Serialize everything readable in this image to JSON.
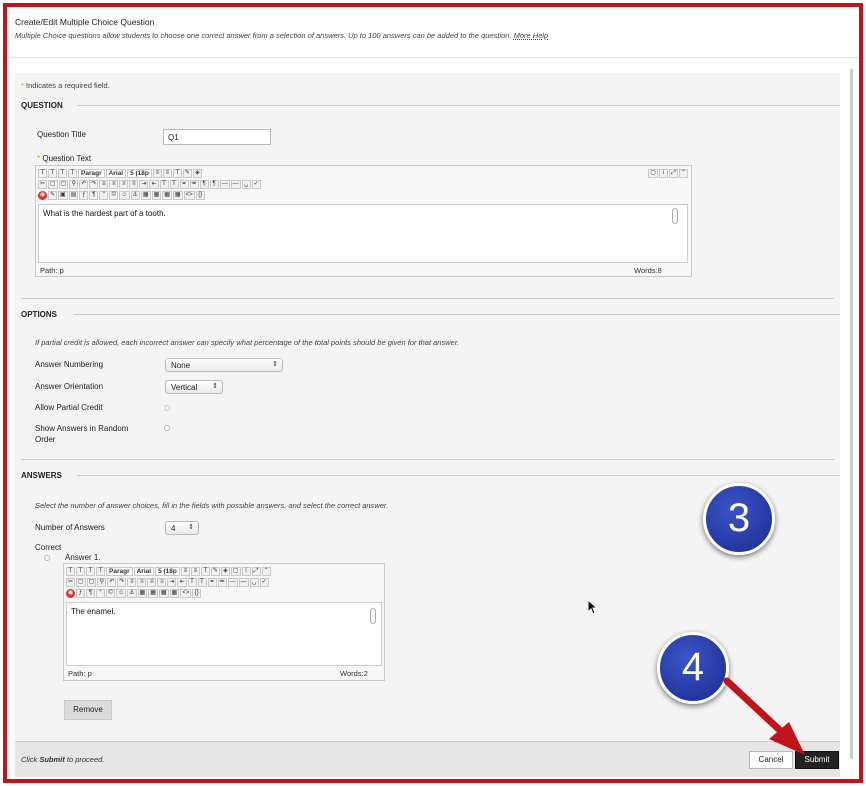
{
  "header": {
    "title": "Create/Edit Multiple Choice Question",
    "description": "Multiple Choice questions allow students to choose one correct answer from a selection of answers. Up to 100 answers can be added to the question.",
    "more_help": "More Help"
  },
  "required_note": {
    "star": "*",
    "text": "Indicates a required field."
  },
  "question": {
    "section_title": "QUESTION",
    "title_label": "Question Title",
    "title_value": "Q1",
    "text_star": "*",
    "text_label": "Question Text",
    "editor": {
      "font_format": "Paragr",
      "font_family": "Arial",
      "font_size": "5 (18p",
      "content": "What is the hardest part of a tooth.",
      "path": "Path: p",
      "words": "Words:8"
    }
  },
  "options": {
    "section_title": "OPTIONS",
    "note": "If partial credit is allowed, each incorrect answer can specify what percentage of the total points should be given for that answer.",
    "numbering_label": "Answer Numbering",
    "numbering_value": "None",
    "orientation_label": "Answer Orientation",
    "orientation_value": "Vertical",
    "partial_credit_label": "Allow Partial Credit",
    "random_order_label": "Show Answers in Random Order"
  },
  "answers": {
    "section_title": "ANSWERS",
    "note": "Select the number of answer choices, fill in the fields with possible answers, and select the correct answer.",
    "count_label": "Number of Answers",
    "count_value": "4",
    "correct_label": "Correct",
    "answer1_label": "Answer 1.",
    "editor": {
      "font_format": "Paragr",
      "font_family": "Arial",
      "font_size": "5 (18p",
      "content": "The enamel.",
      "path": "Path: p",
      "words": "Words:2"
    },
    "remove_label": "Remove"
  },
  "footer": {
    "note_prefix": "Click",
    "note_bold": "Submit",
    "note_suffix": "to proceed.",
    "cancel_label": "Cancel",
    "submit_label": "Submit"
  },
  "annotations": {
    "step3": "3",
    "step4": "4",
    "badge_color": "#1f2f9e",
    "arrow_color": "#c0141a",
    "frame_color": "#c0141a"
  }
}
